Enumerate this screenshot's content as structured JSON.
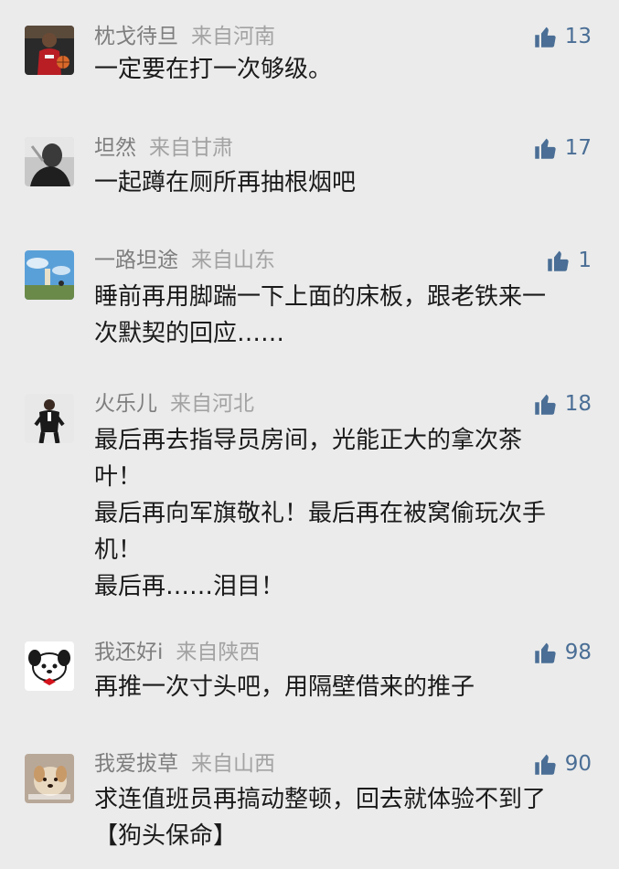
{
  "colors": {
    "background": "#ebebeb",
    "username": "#7e7e7e",
    "location": "#a3a3a3",
    "like_accent": "#4a6e95",
    "text": "#1a1a1a"
  },
  "comments": [
    {
      "username": "枕戈待旦",
      "location": "来自河南",
      "likes": "13",
      "avatar_icon": "basketball-player-avatar",
      "text": "一定要在打一次够级。"
    },
    {
      "username": "坦然",
      "location": "来自甘肃",
      "likes": "17",
      "avatar_icon": "person-photo-avatar",
      "text": "一起蹲在厕所再抽根烟吧"
    },
    {
      "username": "一路坦途",
      "location": "来自山东",
      "likes": "1",
      "avatar_icon": "sky-landscape-avatar",
      "text": "睡前再用脚踹一下上面的床板，跟老铁来一\n次默契的回应……"
    },
    {
      "username": "火乐儿",
      "location": "来自河北",
      "likes": "18",
      "avatar_icon": "man-in-suit-avatar",
      "text": "最后再去指导员房间，光能正大的拿次茶\n叶！\n最后再向军旗敬礼！最后再在被窝偷玩次手\n机！\n最后再……泪目！"
    },
    {
      "username": "我还好i",
      "location": "来自陕西",
      "likes": "98",
      "avatar_icon": "cartoon-dog-avatar",
      "text": "再推一次寸头吧，用隔壁借来的推子"
    },
    {
      "username": "我爱拔草",
      "location": "来自山西",
      "likes": "90",
      "avatar_icon": "puppy-photo-avatar",
      "text": "求连值班员再搞动整顿，回去就体验不到了\n【狗头保命】"
    }
  ]
}
